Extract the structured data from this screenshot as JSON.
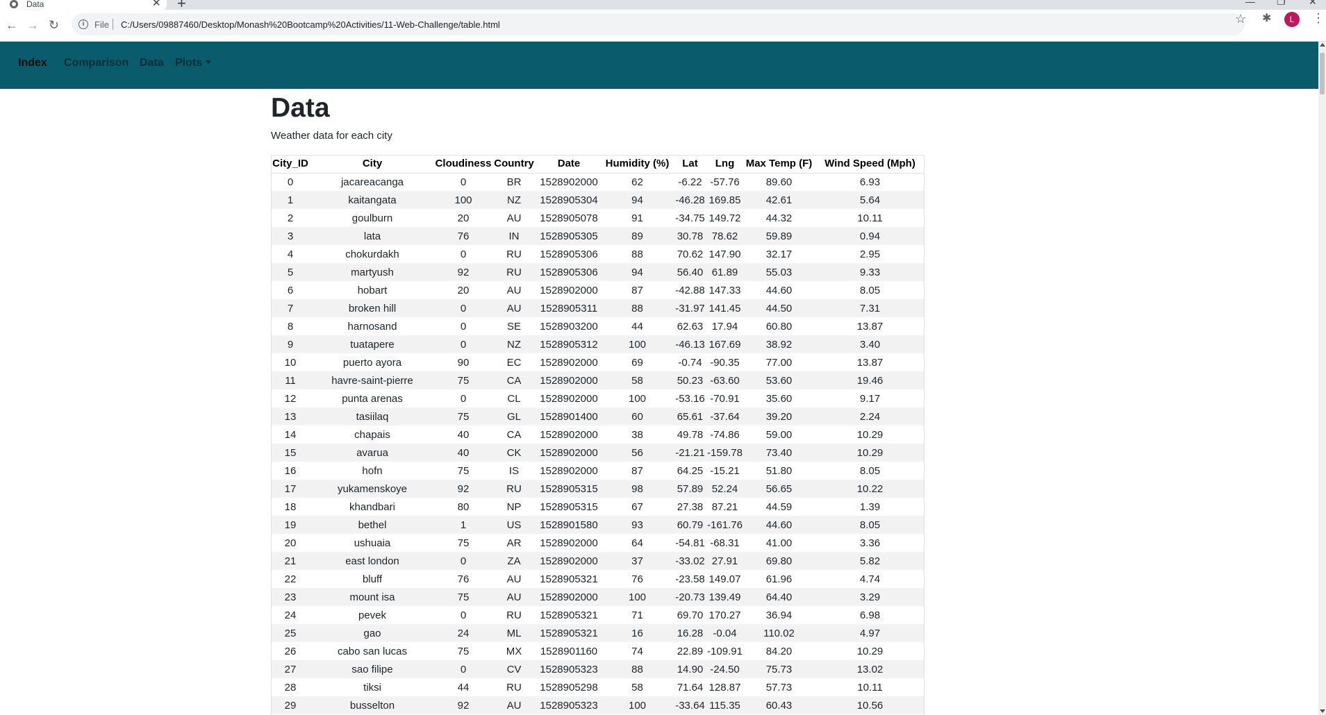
{
  "browser": {
    "tab_title": "Data",
    "tab_close": "✕",
    "new_tab": "+",
    "url_scheme_label": "File",
    "url": "C:/Users/09887460/Desktop/Monash%20Bootcamp%20Activities/11-Web-Challenge/table.html",
    "avatar_letter": "L",
    "icons": {
      "back": "←",
      "forward": "→",
      "reload": "↻",
      "info": "i",
      "star": "☆",
      "extensions": "✱",
      "menu": "⋮",
      "minimize": "—",
      "restore": "❐",
      "close": "✕"
    }
  },
  "navbar": {
    "background_color": "#0a5c6c",
    "items": [
      {
        "label": "Index",
        "active": true
      },
      {
        "label": "Comparison",
        "active": false
      },
      {
        "label": "Data",
        "active": false
      },
      {
        "label": "Plots",
        "active": false,
        "dropdown": true
      }
    ]
  },
  "page": {
    "title": "Data",
    "subtitle": "Weather data for each city"
  },
  "table": {
    "columns": [
      "City_ID",
      "City",
      "Cloudiness",
      "Country",
      "Date",
      "Humidity (%)",
      "Lat",
      "Lng",
      "Max Temp (F)",
      "Wind Speed (Mph)"
    ],
    "rows": [
      [
        "0",
        "jacareacanga",
        "0",
        "BR",
        "1528902000",
        "62",
        "-6.22",
        "-57.76",
        "89.60",
        "6.93"
      ],
      [
        "1",
        "kaitangata",
        "100",
        "NZ",
        "1528905304",
        "94",
        "-46.28",
        "169.85",
        "42.61",
        "5.64"
      ],
      [
        "2",
        "goulburn",
        "20",
        "AU",
        "1528905078",
        "91",
        "-34.75",
        "149.72",
        "44.32",
        "10.11"
      ],
      [
        "3",
        "lata",
        "76",
        "IN",
        "1528905305",
        "89",
        "30.78",
        "78.62",
        "59.89",
        "0.94"
      ],
      [
        "4",
        "chokurdakh",
        "0",
        "RU",
        "1528905306",
        "88",
        "70.62",
        "147.90",
        "32.17",
        "2.95"
      ],
      [
        "5",
        "martyush",
        "92",
        "RU",
        "1528905306",
        "94",
        "56.40",
        "61.89",
        "55.03",
        "9.33"
      ],
      [
        "6",
        "hobart",
        "20",
        "AU",
        "1528902000",
        "87",
        "-42.88",
        "147.33",
        "44.60",
        "8.05"
      ],
      [
        "7",
        "broken hill",
        "0",
        "AU",
        "1528905311",
        "88",
        "-31.97",
        "141.45",
        "44.50",
        "7.31"
      ],
      [
        "8",
        "harnosand",
        "0",
        "SE",
        "1528903200",
        "44",
        "62.63",
        "17.94",
        "60.80",
        "13.87"
      ],
      [
        "9",
        "tuatapere",
        "0",
        "NZ",
        "1528905312",
        "100",
        "-46.13",
        "167.69",
        "38.92",
        "3.40"
      ],
      [
        "10",
        "puerto ayora",
        "90",
        "EC",
        "1528902000",
        "69",
        "-0.74",
        "-90.35",
        "77.00",
        "13.87"
      ],
      [
        "11",
        "havre-saint-pierre",
        "75",
        "CA",
        "1528902000",
        "58",
        "50.23",
        "-63.60",
        "53.60",
        "19.46"
      ],
      [
        "12",
        "punta arenas",
        "0",
        "CL",
        "1528902000",
        "100",
        "-53.16",
        "-70.91",
        "35.60",
        "9.17"
      ],
      [
        "13",
        "tasiilaq",
        "75",
        "GL",
        "1528901400",
        "60",
        "65.61",
        "-37.64",
        "39.20",
        "2.24"
      ],
      [
        "14",
        "chapais",
        "40",
        "CA",
        "1528902000",
        "38",
        "49.78",
        "-74.86",
        "59.00",
        "10.29"
      ],
      [
        "15",
        "avarua",
        "40",
        "CK",
        "1528902000",
        "56",
        "-21.21",
        "-159.78",
        "73.40",
        "10.29"
      ],
      [
        "16",
        "hofn",
        "75",
        "IS",
        "1528902000",
        "87",
        "64.25",
        "-15.21",
        "51.80",
        "8.05"
      ],
      [
        "17",
        "yukamenskoye",
        "92",
        "RU",
        "1528905315",
        "98",
        "57.89",
        "52.24",
        "56.65",
        "10.22"
      ],
      [
        "18",
        "khandbari",
        "80",
        "NP",
        "1528905315",
        "67",
        "27.38",
        "87.21",
        "44.59",
        "1.39"
      ],
      [
        "19",
        "bethel",
        "1",
        "US",
        "1528901580",
        "93",
        "60.79",
        "-161.76",
        "44.60",
        "8.05"
      ],
      [
        "20",
        "ushuaia",
        "75",
        "AR",
        "1528902000",
        "64",
        "-54.81",
        "-68.31",
        "41.00",
        "3.36"
      ],
      [
        "21",
        "east london",
        "0",
        "ZA",
        "1528902000",
        "37",
        "-33.02",
        "27.91",
        "69.80",
        "5.82"
      ],
      [
        "22",
        "bluff",
        "76",
        "AU",
        "1528905321",
        "76",
        "-23.58",
        "149.07",
        "61.96",
        "4.74"
      ],
      [
        "23",
        "mount isa",
        "75",
        "AU",
        "1528902000",
        "100",
        "-20.73",
        "139.49",
        "64.40",
        "3.29"
      ],
      [
        "24",
        "pevek",
        "0",
        "RU",
        "1528905321",
        "71",
        "69.70",
        "170.27",
        "36.94",
        "6.98"
      ],
      [
        "25",
        "gao",
        "24",
        "ML",
        "1528905321",
        "16",
        "16.28",
        "-0.04",
        "110.02",
        "4.97"
      ],
      [
        "26",
        "cabo san lucas",
        "75",
        "MX",
        "1528901160",
        "74",
        "22.89",
        "-109.91",
        "84.20",
        "10.29"
      ],
      [
        "27",
        "sao filipe",
        "0",
        "CV",
        "1528905323",
        "88",
        "14.90",
        "-24.50",
        "75.73",
        "13.02"
      ],
      [
        "28",
        "tiksi",
        "44",
        "RU",
        "1528905298",
        "58",
        "71.64",
        "128.87",
        "57.73",
        "10.11"
      ],
      [
        "29",
        "busselton",
        "92",
        "AU",
        "1528905323",
        "100",
        "-33.64",
        "115.35",
        "60.43",
        "10.56"
      ]
    ]
  }
}
